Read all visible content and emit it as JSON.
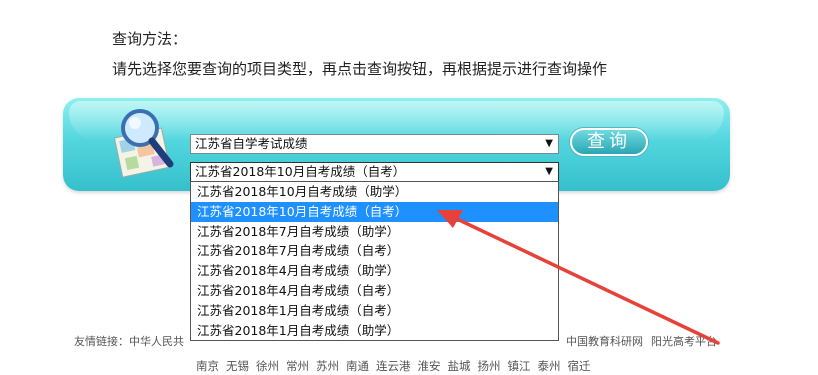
{
  "instructions": {
    "title": "查询方法：",
    "text": "请先选择您要查询的项目类型，再点击查询按钮，再根据提示进行查询操作"
  },
  "form": {
    "category_value": "江苏省自学考试成绩",
    "item_value": "江苏省2018年10月自考成绩（自考）",
    "arrow_glyph": "▼",
    "query_button": "查询"
  },
  "dropdown": {
    "options": [
      "江苏省2018年10月自考成绩（助学）",
      "江苏省2018年10月自考成绩（自考）",
      "江苏省2018年7月自考成绩（助学）",
      "江苏省2018年7月自考成绩（自考）",
      "江苏省2018年4月自考成绩（助学）",
      "江苏省2018年4月自考成绩（自考）",
      "江苏省2018年1月自考成绩（自考）",
      "江苏省2018年1月自考成绩（助学）"
    ],
    "highlighted_index": 1
  },
  "links": {
    "label": "友情链接：中华人民共",
    "visible_items": [
      "中国教育科研网",
      "阳光高考平台"
    ]
  },
  "cities": [
    "南京",
    "无锡",
    "徐州",
    "常州",
    "苏州",
    "南通",
    "连云港",
    "淮安",
    "盐城",
    "扬州",
    "镇江",
    "泰州",
    "宿迁"
  ],
  "colors": {
    "panel": "#53d6de",
    "highlight": "#1e90ff",
    "annotation_arrow": "#e8413a"
  },
  "icons": {
    "search_illustration": "magnifier-over-map-icon"
  }
}
